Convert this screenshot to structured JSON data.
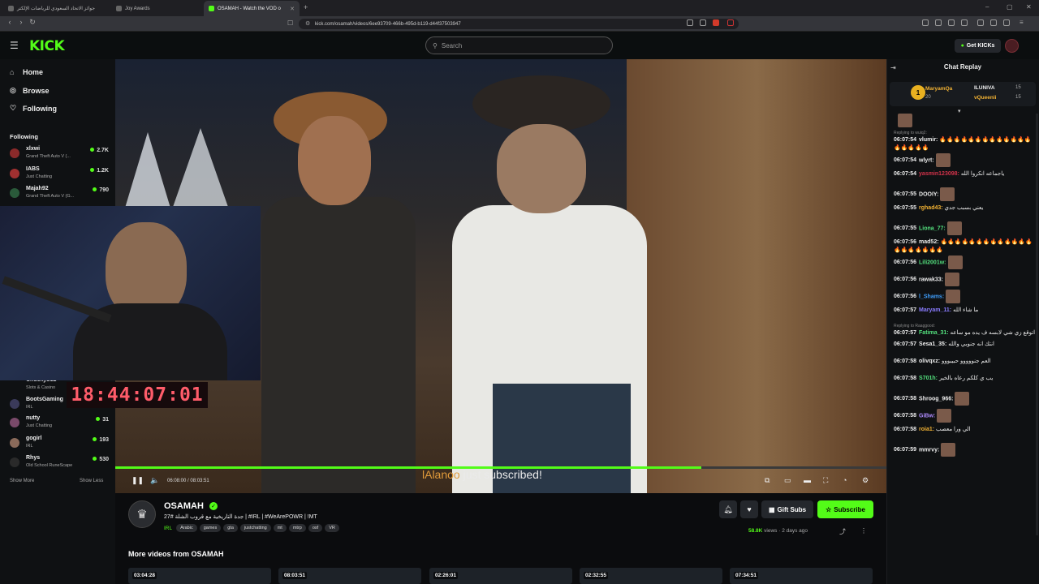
{
  "browser": {
    "tabs": [
      {
        "title": "جوائز الاتحاد السعودي للرياضات الإلكتر"
      },
      {
        "title": "Joy Awards"
      },
      {
        "title": "OSAMAH - Watch the VOD o"
      }
    ],
    "url": "kick.com/osamah/videos/6ee93709-466b-495d-b119-d44f37503947"
  },
  "header": {
    "logo": "KICK",
    "search_placeholder": "Search",
    "get_kicks": "Get KICKs"
  },
  "sidebar": {
    "nav": [
      {
        "label": "Home",
        "icon": "home-icon"
      },
      {
        "label": "Browse",
        "icon": "compass-icon"
      },
      {
        "label": "Following",
        "icon": "heart-icon"
      }
    ],
    "following_heading": "Following",
    "channels": [
      {
        "name": "xlxwi",
        "game": "Grand Theft Auto V (...",
        "viewers": "2.7K"
      },
      {
        "name": "IABS",
        "game": "Just Chatting",
        "viewers": "1.2K"
      },
      {
        "name": "Majah92",
        "game": "Grand Theft Auto V (G...",
        "viewers": "790"
      },
      {
        "name": "Chuckyb12",
        "game": "Slots & Casino",
        "viewers": ""
      },
      {
        "name": "BootsGaming",
        "game": "IRL",
        "viewers": ""
      },
      {
        "name": "nutty",
        "game": "Just Chatting",
        "viewers": "31"
      },
      {
        "name": "gogirl",
        "game": "IRL",
        "viewers": "193"
      },
      {
        "name": "Rhys",
        "game": "Old School RuneScape",
        "viewers": "530"
      }
    ],
    "show_more": "Show More",
    "show_less": "Show Less"
  },
  "player": {
    "current_time": "06:08:00",
    "duration": "08:03:51",
    "progress_fraction": 0.76,
    "subscribed_name": "lAlanoo",
    "subscribed_text": "just subscribed!",
    "overlay_timer": "18:44:07:01"
  },
  "video_info": {
    "channel_name": "OSAMAH",
    "title": "جدة التاريخية مع قروب الشلة #27 | #IRL | #WeArePOWR | !MT",
    "category": "IRL",
    "tags": [
      "Arabic",
      "games",
      "gta",
      "justchatting",
      "mt",
      "mtrp",
      "osf",
      "VR"
    ],
    "views": "58.8K",
    "views_label": "views",
    "posted": "2 days ago",
    "gift_subs": "Gift Subs",
    "subscribe": "Subscribe",
    "more_videos_heading": "More videos from OSAMAH",
    "more_videos": [
      {
        "duration": "03:04:28"
      },
      {
        "duration": "08:03:51"
      },
      {
        "duration": "02:26:01"
      },
      {
        "duration": "02:32:55"
      },
      {
        "duration": "07:34:51"
      }
    ]
  },
  "chat": {
    "title": "Chat Replay",
    "pinned": [
      {
        "name": "MaryamQa",
        "count": "20"
      },
      {
        "name": "ILUNIVA",
        "count": "15"
      },
      {
        "name": "vQueenii",
        "count": "15"
      }
    ],
    "messages": [
      {
        "time": "",
        "user": "",
        "text": "",
        "reply": "",
        "color": "#eeeeee"
      },
      {
        "time": "06:07:54",
        "user": "vlumir:",
        "text": "🔥🔥🔥🔥🔥🔥🔥🔥🔥🔥🔥🔥🔥🔥🔥🔥🔥🔥",
        "reply": "Replying to wuiq2:",
        "color": "#eeeeee"
      },
      {
        "time": "06:07:54",
        "user": "wlyrt:",
        "text": "",
        "reply": "",
        "color": "#eeeeee"
      },
      {
        "time": "06:07:54",
        "user": "yasmin123098:",
        "text": "ياجماعه انكروا الله",
        "reply": "",
        "color": "#d2324a"
      },
      {
        "time": "06:07:55",
        "user": "DOOIY:",
        "text": "",
        "reply": "",
        "color": "#eeeeee"
      },
      {
        "time": "06:07:55",
        "user": "rghad43:",
        "text": "يعني بسبب جدي",
        "reply": "",
        "color": "#f2b233"
      },
      {
        "time": "06:07:55",
        "user": "Liona_77:",
        "text": "",
        "reply": "",
        "color": "#53e07d"
      },
      {
        "time": "06:07:56",
        "user": "mad52:",
        "text": "🔥🔥🔥🔥🔥🔥🔥🔥🔥🔥🔥🔥🔥🔥🔥🔥🔥🔥🔥🔥",
        "reply": "",
        "color": "#eeeeee"
      },
      {
        "time": "06:07:56",
        "user": "Lili2001w:",
        "text": "",
        "reply": "",
        "color": "#53e07d"
      },
      {
        "time": "06:07:56",
        "user": "rawak33:",
        "text": "",
        "reply": "",
        "color": "#eeeeee"
      },
      {
        "time": "06:07:56",
        "user": "l_Shams:",
        "text": "",
        "reply": "",
        "color": "#3fa0ff"
      },
      {
        "time": "06:07:57",
        "user": "Maryam_11:",
        "text": "ما شاء الله",
        "reply": "",
        "color": "#8a7cff"
      },
      {
        "time": "06:07:57",
        "user": "Fatima_31:",
        "text": "اتوقع زي شي لابسه ف يده مو ساعه",
        "reply": "Replying to Raaggood:",
        "color": "#53e07d"
      },
      {
        "time": "06:07:57",
        "user": "Sesa1_35:",
        "text": "انتك انه جنوبي والله",
        "reply": "",
        "color": "#eeeeee"
      },
      {
        "time": "06:07:58",
        "user": "olivqxz:",
        "text": "العم جنووووو حبيبووو",
        "reply": "",
        "color": "#eeeeee"
      },
      {
        "time": "06:07:58",
        "user": "S701h:",
        "text": "يب ي كلكم رعاه بالخير",
        "reply": "",
        "color": "#53e07d"
      },
      {
        "time": "06:07:58",
        "user": "Shroog_966:",
        "text": "",
        "reply": "",
        "color": "#eeeeee"
      },
      {
        "time": "06:07:58",
        "user": "GiBw:",
        "text": "",
        "reply": "",
        "color": "#b08cff"
      },
      {
        "time": "06:07:58",
        "user": "roia1:",
        "text": "الي ورا معصب",
        "reply": "",
        "color": "#f2b233"
      },
      {
        "time": "06:07:59",
        "user": "mmrvy:",
        "text": "",
        "reply": "",
        "color": "#eeeeee"
      }
    ]
  },
  "colors": {
    "accent": "#53fc18",
    "timer": "#ff5c6a"
  }
}
